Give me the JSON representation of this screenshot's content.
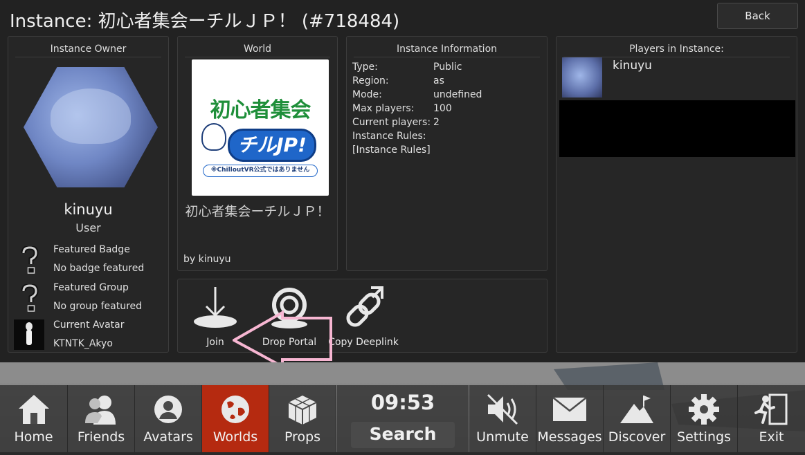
{
  "header": {
    "title": "Instance: 初心者集会ーチルＪＰ！ (#718484)",
    "back_label": "Back"
  },
  "owner": {
    "section_title": "Instance Owner",
    "name": "kinuyu",
    "role": "User",
    "featured_badge_label": "Featured Badge",
    "featured_badge_value": "No badge featured",
    "featured_group_label": "Featured Group",
    "featured_group_value": "No group featured",
    "current_avatar_label": "Current Avatar",
    "current_avatar_value": "KTNTK_Akyo"
  },
  "world": {
    "section_title": "World",
    "thumb_title": "初心者集会",
    "thumb_badge": "チルJP!",
    "thumb_note": "※ChilloutVR公式ではありません",
    "name": "初心者集会ーチルＪＰ！",
    "author": "by kinuyu"
  },
  "instance_info": {
    "section_title": "Instance Information",
    "rows": [
      {
        "key": "Type:",
        "value": "Public"
      },
      {
        "key": "Region:",
        "value": "as"
      },
      {
        "key": "Mode:",
        "value": "undefined"
      },
      {
        "key": "Max players:",
        "value": "100"
      },
      {
        "key": "Current players:",
        "value": "2"
      },
      {
        "key": "Instance Rules:",
        "value": ""
      },
      {
        "key": "[Instance Rules]",
        "value": ""
      }
    ]
  },
  "players": {
    "section_title": "Players in Instance:",
    "list": [
      {
        "name": "kinuyu"
      }
    ]
  },
  "actions": {
    "join": "Join",
    "drop_portal": "Drop Portal",
    "copy_deeplink": "Copy Deeplink"
  },
  "nav": {
    "home": "Home",
    "friends": "Friends",
    "avatars": "Avatars",
    "worlds": "Worlds",
    "props": "Props",
    "clock": "09:53",
    "search": "Search",
    "unmute": "Unmute",
    "messages": "Messages",
    "discover": "Discover",
    "settings": "Settings",
    "exit": "Exit"
  },
  "colors": {
    "panel_bg": "#222222",
    "card_bg": "#262626",
    "active_nav": "#b52a10",
    "annotation_arrow": "#f7b6d2"
  },
  "icons": {
    "join": "download-arrow-icon",
    "drop_portal": "portal-icon",
    "copy_deeplink": "link-icon"
  }
}
